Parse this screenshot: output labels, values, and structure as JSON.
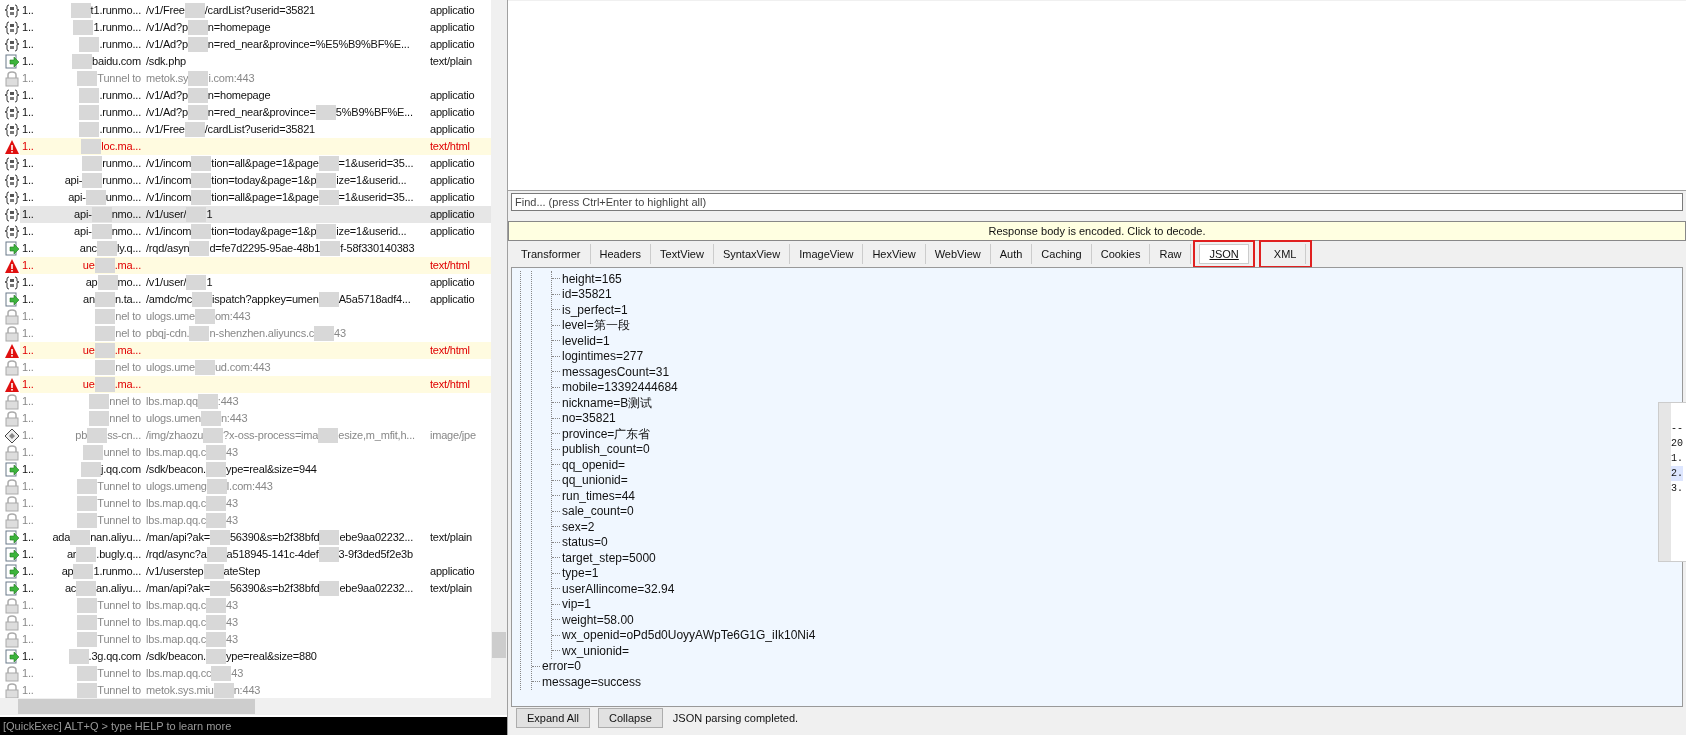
{
  "sessions": [
    {
      "kind": "json",
      "selected": false,
      "num": "1..",
      "host": [
        "t1.runmo..."
      ],
      "url": [
        "/v1/Free",
        "/cardList?userid=35821"
      ],
      "type": "applicatio"
    },
    {
      "kind": "json",
      "selected": false,
      "num": "1..",
      "host": [
        "1.runmo..."
      ],
      "url": [
        "/v1/Ad?p",
        "n=homepage"
      ],
      "type": "applicatio"
    },
    {
      "kind": "json",
      "selected": false,
      "num": "1..",
      "host": [
        ".runmo..."
      ],
      "url": [
        "/v1/Ad?p",
        "n=red_near&province=%E5%B9%BF%E..."
      ],
      "type": "applicatio"
    },
    {
      "kind": "arrow",
      "selected": false,
      "num": "1..",
      "host": [
        "baidu.com"
      ],
      "url": [
        "/sdk.php"
      ],
      "type": "text/plain"
    },
    {
      "kind": "lock",
      "selected": false,
      "num": "1..",
      "host": [
        "Tunnel to"
      ],
      "url": [
        "metok.sy",
        "i.com:443"
      ]
    },
    {
      "kind": "json",
      "selected": false,
      "num": "1..",
      "host": [
        ".runmo..."
      ],
      "url": [
        "/v1/Ad?p",
        "n=homepage"
      ],
      "type": "applicatio"
    },
    {
      "kind": "json",
      "selected": false,
      "num": "1..",
      "host": [
        ".runmo..."
      ],
      "url": [
        "/v1/Ad?p",
        "n=red_near&province=",
        "5%B9%BF%E..."
      ],
      "type": "applicatio"
    },
    {
      "kind": "json",
      "selected": false,
      "num": "1..",
      "host": [
        ".runmo..."
      ],
      "url": [
        "/v1/Free",
        "/cardList?userid=35821"
      ],
      "type": "applicatio"
    },
    {
      "kind": "warning",
      "selected": false,
      "num": "1..",
      "host": [
        "loc.ma..."
      ],
      "type": "text/html"
    },
    {
      "kind": "json",
      "selected": false,
      "num": "1..",
      "host": [
        "runmo..."
      ],
      "url": [
        "/v1/incom",
        "tion=all&page=1&page",
        "=1&userid=35..."
      ],
      "type": "applicatio"
    },
    {
      "kind": "json",
      "selected": false,
      "num": "1..",
      "host": [
        "api-",
        "runmo..."
      ],
      "url": [
        "/v1/incom",
        "tion=today&page=1&p",
        "ize=1&userid..."
      ],
      "type": "applicatio"
    },
    {
      "kind": "json",
      "selected": false,
      "num": "1..",
      "host": [
        "api-",
        "unmo..."
      ],
      "url": [
        "/v1/incom",
        "tion=all&page=1&page",
        "=1&userid=35..."
      ],
      "type": "applicatio"
    },
    {
      "kind": "json",
      "selected": true,
      "num": "1..",
      "host": [
        "api-",
        "nmo..."
      ],
      "url": [
        "/v1/user/",
        "1"
      ],
      "type": "applicatio"
    },
    {
      "kind": "json",
      "selected": false,
      "num": "1..",
      "host": [
        "api-",
        "nmo..."
      ],
      "url": [
        "/v1/incom",
        "tion=today&page=1&p",
        "ize=1&userid..."
      ],
      "type": "applicatio"
    },
    {
      "kind": "arrow",
      "selected": false,
      "num": "1..",
      "host": [
        "anc",
        "ly.q..."
      ],
      "url": [
        "/rqd/asyn",
        "d=fe7d2295-95ae-48b1",
        "f-58f330140383"
      ]
    },
    {
      "kind": "warning",
      "selected": false,
      "num": "1..",
      "host": [
        "ue",
        ".ma..."
      ],
      "type": "text/html"
    },
    {
      "kind": "json",
      "selected": false,
      "num": "1..",
      "host": [
        "ap",
        "mo..."
      ],
      "url": [
        "/v1/user/",
        "1"
      ],
      "type": "applicatio"
    },
    {
      "kind": "arrow",
      "selected": false,
      "num": "1..",
      "host": [
        "an",
        "n.ta..."
      ],
      "url": [
        "/amdc/mc",
        "ispatch?appkey=umen",
        "A5a5718adf4..."
      ],
      "type": "applicatio"
    },
    {
      "kind": "lock",
      "selected": false,
      "num": "1..",
      "host": [
        "nel to"
      ],
      "url": [
        "ulogs.ume",
        "om:443"
      ]
    },
    {
      "kind": "lock",
      "selected": false,
      "num": "1..",
      "host": [
        "nel to"
      ],
      "url": [
        "pbqj-cdn.",
        "n-shenzhen.aliyuncs.c",
        "43"
      ]
    },
    {
      "kind": "warning",
      "selected": false,
      "num": "1..",
      "host": [
        "ue",
        ".ma..."
      ],
      "type": "text/html"
    },
    {
      "kind": "lock",
      "selected": false,
      "num": "1..",
      "host": [
        "nel to"
      ],
      "url": [
        "ulogs.ume",
        "ud.com:443"
      ]
    },
    {
      "kind": "warning",
      "selected": false,
      "num": "1..",
      "host": [
        "ue",
        ".ma..."
      ],
      "type": "text/html"
    },
    {
      "kind": "lock",
      "selected": false,
      "num": "1..",
      "host": [
        "nnel to"
      ],
      "url": [
        "lbs.map.qq",
        ":443"
      ]
    },
    {
      "kind": "lock",
      "selected": false,
      "num": "1..",
      "host": [
        "nnel to"
      ],
      "url": [
        "ulogs.umen",
        "n:443"
      ]
    },
    {
      "kind": "image",
      "selected": false,
      "num": "1..",
      "host": [
        "pb",
        "ss-cn..."
      ],
      "url": [
        "/img/zhaozu",
        "?x-oss-process=ima",
        "esize,m_mfit,h..."
      ],
      "type": "image/jpe"
    },
    {
      "kind": "lock",
      "selected": false,
      "num": "1..",
      "host": [
        "unnel to"
      ],
      "url": [
        "lbs.map.qq.c",
        "43"
      ]
    },
    {
      "kind": "arrow",
      "selected": false,
      "num": "1..",
      "host": [
        "j.qq.com"
      ],
      "url": [
        "/sdk/beacon.",
        "ype=real&size=944"
      ]
    },
    {
      "kind": "lock",
      "selected": false,
      "num": "1..",
      "host": [
        "Tunnel to"
      ],
      "url": [
        "ulogs.umeng",
        "l.com:443"
      ]
    },
    {
      "kind": "lock",
      "selected": false,
      "num": "1..",
      "host": [
        "Tunnel to"
      ],
      "url": [
        "lbs.map.qq.c",
        "43"
      ]
    },
    {
      "kind": "lock",
      "selected": false,
      "num": "1..",
      "host": [
        "Tunnel to"
      ],
      "url": [
        "lbs.map.qq.c",
        "43"
      ]
    },
    {
      "kind": "arrow",
      "selected": false,
      "num": "1..",
      "host": [
        "ada",
        "nan.aliyu..."
      ],
      "url": [
        "/man/api?ak=",
        "56390&s=b2f38bfd",
        "ebe9aa02232..."
      ],
      "type": "text/plain"
    },
    {
      "kind": "arrow",
      "selected": false,
      "num": "1..",
      "host": [
        "ar",
        ".bugly.q..."
      ],
      "url": [
        "/rqd/async?a",
        "a518945-141c-4def",
        "3-9f3ded5f2e3b"
      ]
    },
    {
      "kind": "arrow",
      "selected": false,
      "num": "1..",
      "host": [
        "ap",
        "1.runmo..."
      ],
      "url": [
        "/v1/userstep",
        "ateStep"
      ],
      "type": "applicatio"
    },
    {
      "kind": "arrow",
      "selected": false,
      "num": "1..",
      "host": [
        "ac",
        "an.aliyu..."
      ],
      "url": [
        "/man/api?ak=",
        "56390&s=b2f38bfd",
        "ebe9aa02232..."
      ],
      "type": "text/plain"
    },
    {
      "kind": "lock",
      "selected": false,
      "num": "1..",
      "host": [
        "Tunnel to"
      ],
      "url": [
        "lbs.map.qq.c",
        "43"
      ]
    },
    {
      "kind": "lock",
      "selected": false,
      "num": "1..",
      "host": [
        "Tunnel to"
      ],
      "url": [
        "lbs.map.qq.c",
        "43"
      ]
    },
    {
      "kind": "lock",
      "selected": false,
      "num": "1..",
      "host": [
        "Tunnel to"
      ],
      "url": [
        "lbs.map.qq.c",
        "43"
      ]
    },
    {
      "kind": "arrow",
      "selected": false,
      "num": "1..",
      "host": [
        ".3g.qq.com"
      ],
      "url": [
        "/sdk/beacon.",
        "ype=real&size=880"
      ]
    },
    {
      "kind": "lock",
      "selected": false,
      "num": "1..",
      "host": [
        "Tunnel to"
      ],
      "url": [
        "lbs.map.qq.cc",
        "43"
      ]
    },
    {
      "kind": "lock",
      "selected": false,
      "num": "1..",
      "host": [
        "Tunnel to"
      ],
      "url": [
        "metok.sys.miu",
        "n:443"
      ]
    }
  ],
  "quickexec": "[QuickExec] ALT+Q > type HELP to learn more",
  "find": {
    "placeholder": "Find... (press Ctrl+Enter to highlight all)"
  },
  "notice": "Response body is encoded. Click to decode.",
  "tabs": [
    {
      "label": "Transformer",
      "selected": false,
      "highlighted": false
    },
    {
      "label": "Headers",
      "selected": false,
      "highlighted": false
    },
    {
      "label": "TextView",
      "selected": false,
      "highlighted": false
    },
    {
      "label": "SyntaxView",
      "selected": false,
      "highlighted": false
    },
    {
      "label": "ImageView",
      "selected": false,
      "highlighted": false
    },
    {
      "label": "HexView",
      "selected": false,
      "highlighted": false
    },
    {
      "label": "WebView",
      "selected": false,
      "highlighted": false
    },
    {
      "label": "Auth",
      "selected": false,
      "highlighted": false
    },
    {
      "label": "Caching",
      "selected": false,
      "highlighted": false
    },
    {
      "label": "Cookies",
      "selected": false,
      "highlighted": false
    },
    {
      "label": "Raw",
      "selected": false,
      "highlighted": false
    },
    {
      "label": "JSON",
      "selected": true,
      "highlighted": true
    },
    {
      "label": "XML",
      "selected": false,
      "highlighted": true
    }
  ],
  "tree": {
    "children": [
      {
        "children": [
          {
            "label": "height=165"
          },
          {
            "label": "id=35821"
          },
          {
            "label": "is_perfect=1"
          },
          {
            "label": "level=第一段"
          },
          {
            "label": "levelid=1"
          },
          {
            "label": "logintimes=277"
          },
          {
            "label": "messagesCount=31"
          },
          {
            "label": "mobile=13392444684"
          },
          {
            "label": "nickname=B测试"
          },
          {
            "label": "no=35821"
          },
          {
            "label": "province=广东省"
          },
          {
            "label": "publish_count=0"
          },
          {
            "label": "qq_openid="
          },
          {
            "label": "qq_unionid="
          },
          {
            "label": "run_times=44"
          },
          {
            "label": "sale_count=0"
          },
          {
            "label": "sex=2"
          },
          {
            "label": "status=0"
          },
          {
            "label": "target_step=5000"
          },
          {
            "label": "type=1"
          },
          {
            "label": "userAllincome=32.94"
          },
          {
            "label": "vip=1"
          },
          {
            "label": "weight=58.00"
          },
          {
            "label": "wx_openid=oPd5d0UoyyAWpTe6G1G_iIk10Ni4"
          },
          {
            "label": "wx_unionid="
          }
        ]
      },
      {
        "label": "error=0"
      },
      {
        "label": "message=success"
      }
    ]
  },
  "popup": {
    "lines": [
      {
        "text": "--",
        "selected": false
      },
      {
        "text": "20",
        "selected": false
      },
      {
        "text": "1.",
        "selected": false
      },
      {
        "text": "2.",
        "selected": true
      },
      {
        "text": "3.",
        "selected": false
      }
    ]
  },
  "buttons": [
    "Expand All",
    "Collapse"
  ],
  "status": "JSON parsing completed."
}
